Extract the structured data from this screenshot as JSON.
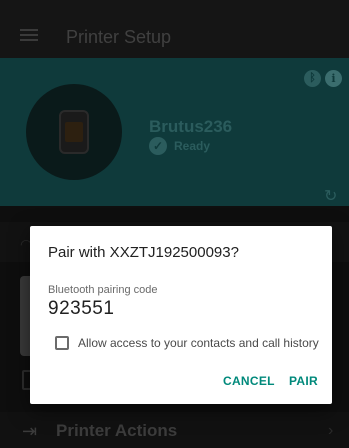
{
  "appbar": {
    "title": "Printer Setup"
  },
  "printer": {
    "name": "Brutus236",
    "status": "Ready"
  },
  "actions": {
    "label": "Printer Actions"
  },
  "dialog": {
    "title": "Pair with XXZTJ192500093?",
    "field_label": "Bluetooth pairing code",
    "pairing_code": "923551",
    "checkbox_label": "Allow access to your contacts and call history",
    "checkbox_checked": false,
    "cancel_label": "CANCEL",
    "pair_label": "PAIR",
    "accent_color": "#00897b"
  },
  "icons": {
    "menu": "menu-icon",
    "bluetooth": "bluetooth-icon",
    "info": "info-icon",
    "refresh": "refresh-icon",
    "wifi": "wifi-icon",
    "document": "document-icon",
    "printer_actions": "printer-actions-icon",
    "chevron": "chevron-right-icon"
  }
}
